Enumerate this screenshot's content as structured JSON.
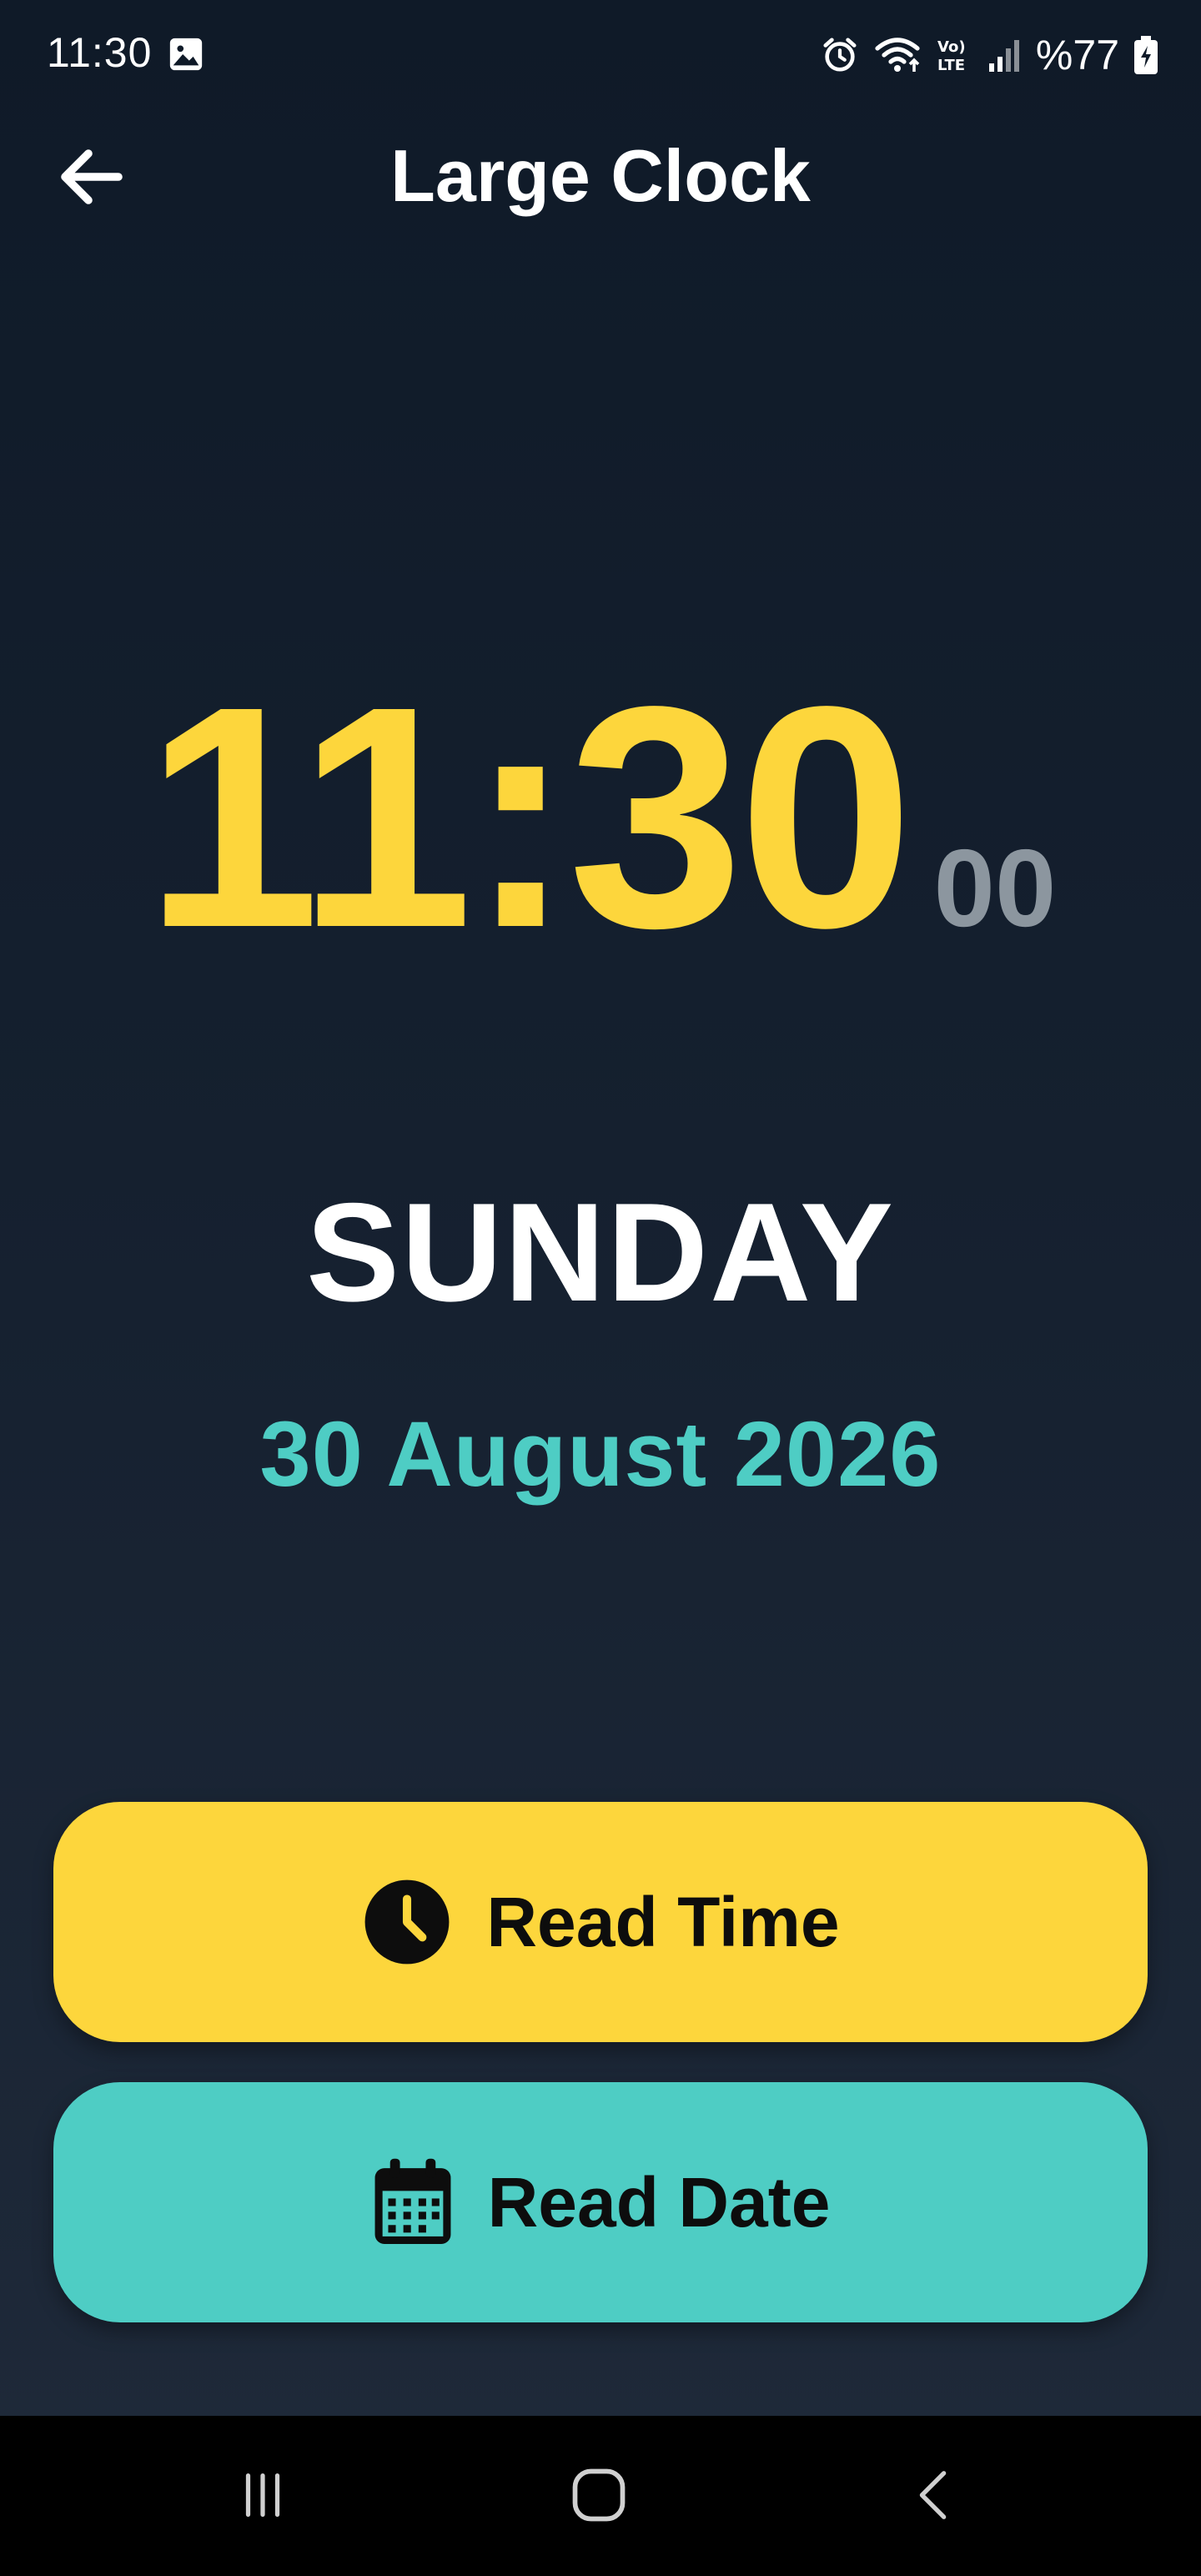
{
  "status_bar": {
    "time": "11:30",
    "battery": "%77",
    "icons": [
      "gallery-icon",
      "alarm-icon",
      "wifi-icon",
      "volte-icon",
      "signal-icon",
      "battery-icon"
    ]
  },
  "header": {
    "title": "Large Clock",
    "back_icon": "arrow-left-icon"
  },
  "clock": {
    "time": "11:30",
    "seconds": "00"
  },
  "date": {
    "day": "SUNDAY",
    "full_date": "30 August 2026"
  },
  "buttons": {
    "read_time": {
      "label": "Read Time",
      "icon": "clock-icon",
      "color": "#fdd63c"
    },
    "read_date": {
      "label": "Read Date",
      "icon": "calendar-icon",
      "color": "#4ecdc4"
    }
  },
  "colors": {
    "background": "#15202f",
    "time_accent": "#fdd63c",
    "date_accent": "#4ecdc4",
    "seconds": "#8c969f"
  },
  "nav_bar": {
    "icons": [
      "recents-icon",
      "home-icon",
      "back-icon"
    ]
  }
}
